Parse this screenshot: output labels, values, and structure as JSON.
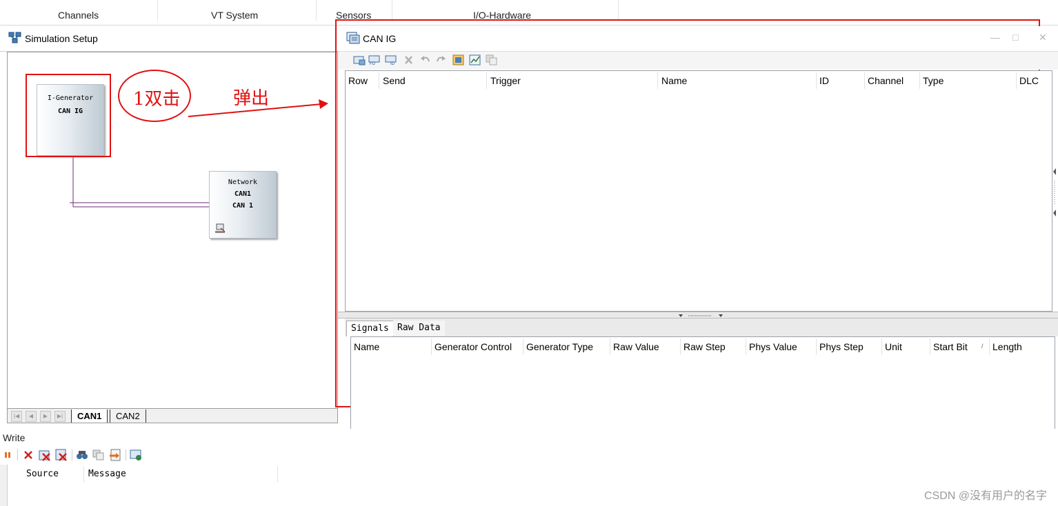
{
  "ribbon": {
    "groups": [
      "Channels",
      "VT System",
      "Sensors",
      "I/O-Hardware"
    ]
  },
  "simulation_setup": {
    "title": "Simulation Setup",
    "blocks": {
      "generator": {
        "line1": "I-Generator",
        "line2": "CAN IG"
      },
      "network": {
        "line1": "Network",
        "line2": "CAN1",
        "line3": "CAN 1"
      }
    },
    "tabs": [
      "CAN1",
      "CAN2"
    ],
    "active_tab": "CAN1"
  },
  "annotation": {
    "step_text": "1双击",
    "arrow_text": "弹出",
    "color": "#e01010"
  },
  "can_ig": {
    "title": "CAN IG",
    "toolbar_icons": [
      "add-message-icon",
      "add-fd-message-icon",
      "add-id-message-icon",
      "delete-icon",
      "undo-icon",
      "redo-icon",
      "select-database-icon",
      "signal-chart-icon",
      "copy-icon"
    ],
    "message_columns": [
      "Row",
      "Send",
      "Trigger",
      "Name",
      "ID",
      "Channel",
      "Type",
      "DLC"
    ],
    "lower_tabs": [
      "Signals",
      "Raw Data"
    ],
    "active_lower_tab": "Signals",
    "signal_columns": [
      "Name",
      "Generator Control",
      "Generator Type",
      "Raw Value",
      "Raw Step",
      "Phys Value",
      "Phys Step",
      "Unit",
      "Start Bit",
      "Length"
    ]
  },
  "write": {
    "title": "Write",
    "toolbar_icons": [
      "pause-icon",
      "clear-icon",
      "clear-filtered-icon",
      "clear-all-icon",
      "find-icon",
      "copy-icon",
      "export-icon",
      "settings-icon"
    ],
    "columns": [
      "Source",
      "Message"
    ]
  },
  "watermark": "CSDN @没有用户的名字"
}
